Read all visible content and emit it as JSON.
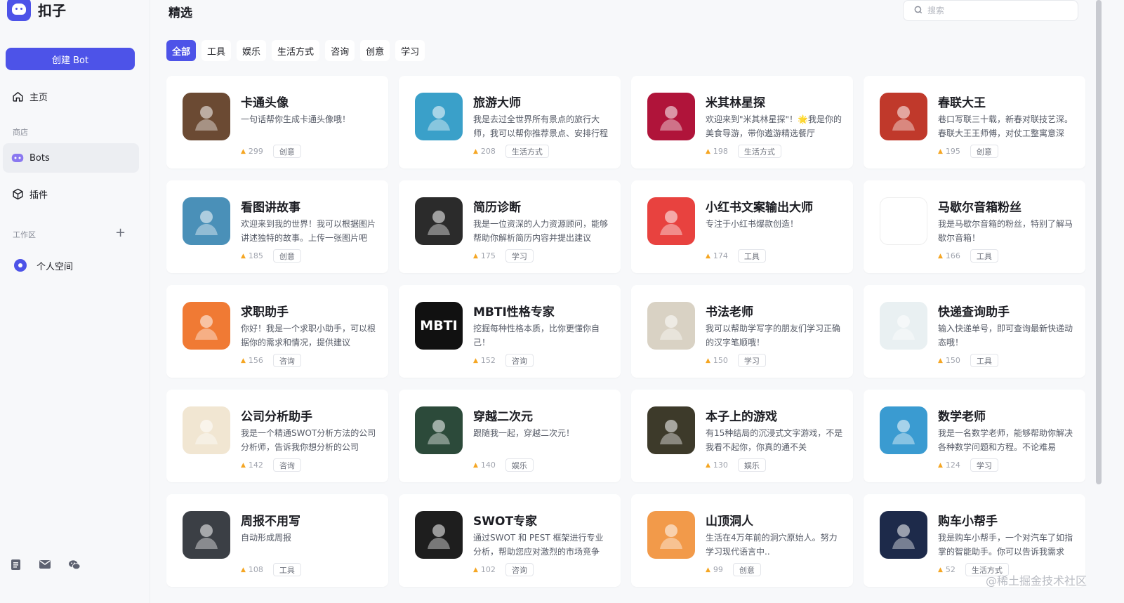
{
  "app": {
    "name": "扣子"
  },
  "sidebar": {
    "create_label": "创建 Bot",
    "home_label": "主页",
    "store_label": "商店",
    "bots_label": "Bots",
    "plugins_label": "插件",
    "workspace_label": "工作区",
    "personal_label": "个人空间"
  },
  "header": {
    "title": "精选",
    "search_placeholder": "搜索"
  },
  "tabs": [
    "全部",
    "工具",
    "娱乐",
    "生活方式",
    "咨询",
    "创意",
    "学习"
  ],
  "cards": [
    {
      "title": "卡通头像",
      "desc": "一句话帮你生成卡通头像哦！",
      "count": "299",
      "tag": "创意",
      "bg": "#6b4a33",
      "icon": "cartoon-girl-icon"
    },
    {
      "title": "旅游大师",
      "desc": "我是去过全世界所有景点的旅行大师，我可以帮你推荐景点、安排行程",
      "count": "208",
      "tag": "生活方式",
      "bg": "#3aa0c9",
      "icon": "traveler-icon"
    },
    {
      "title": "米其林星探",
      "desc": "欢迎来到\"米其林星探\"！🌟我是你的美食导游，带你遨游精选餐厅",
      "count": "198",
      "tag": "生活方式",
      "bg": "#b0143a",
      "icon": "michelin-flower-icon"
    },
    {
      "title": "春联大王",
      "desc": "巷口写联三十载，新春对联技艺深。春联大王王师傅，对仗工整寓意深",
      "count": "195",
      "tag": "创意",
      "bg": "#c0392b",
      "icon": "couplet-master-icon"
    },
    {
      "title": "看图讲故事",
      "desc": "欢迎来到我的世界！我可以根据图片讲述独特的故事。上传一张图片吧",
      "count": "185",
      "tag": "创意",
      "bg": "#4a90b8",
      "icon": "storybook-icon"
    },
    {
      "title": "简历诊断",
      "desc": "我是一位资深的人力资源顾问，能够帮助你解析简历内容并提出建议",
      "count": "175",
      "tag": "学习",
      "bg": "#2b2b2b",
      "icon": "recruiter-icon"
    },
    {
      "title": "小红书文案输出大师",
      "desc": "专注于小红书爆款创造！",
      "count": "174",
      "tag": "工具",
      "bg": "#e8423f",
      "icon": "xiaohongshu-icon"
    },
    {
      "title": "马歇尔音箱粉丝",
      "desc": "我是马歇尔音箱的粉丝，特别了解马歇尔音箱！",
      "count": "166",
      "tag": "工具",
      "bg": "#ffffff",
      "icon": "speaker-icon"
    },
    {
      "title": "求职助手",
      "desc": "你好！我是一个求职小助手，可以根据你的需求和情况，提供建议",
      "count": "156",
      "tag": "咨询",
      "bg": "#f07a34",
      "icon": "job-assistant-icon"
    },
    {
      "title": "MBTI性格专家",
      "desc": "挖掘每种性格本质，比你更懂你自己！",
      "count": "152",
      "tag": "咨询",
      "bg": "#111111",
      "icon": "mbti-icon",
      "avatar_text": "MBTI"
    },
    {
      "title": "书法老师",
      "desc": "我可以帮助学写字的朋友们学习正确的汉字笔顺哦！",
      "count": "150",
      "tag": "学习",
      "bg": "#d9d2c4",
      "icon": "calligraphy-teacher-icon"
    },
    {
      "title": "快递查询助手",
      "desc": "输入快递单号，即可查询最新快递动态哦！",
      "count": "150",
      "tag": "工具",
      "bg": "#e9f0f2",
      "icon": "delivery-truck-icon"
    },
    {
      "title": "公司分析助手",
      "desc": "我是一个精通SWOT分析方法的公司分析师，告诉我你想分析的公司",
      "count": "142",
      "tag": "咨询",
      "bg": "#f1e6d2",
      "icon": "company-chart-icon"
    },
    {
      "title": "穿越二次元",
      "desc": "跟随我一起，穿越二次元！",
      "count": "140",
      "tag": "娱乐",
      "bg": "#2c4a3a",
      "icon": "anime-character-icon"
    },
    {
      "title": "本子上的游戏",
      "desc": "有15种结局的沉浸式文字游戏，不是我看不起你，你真的通不关",
      "count": "130",
      "tag": "娱乐",
      "bg": "#3d3a2a",
      "icon": "notebook-game-icon"
    },
    {
      "title": "数学老师",
      "desc": "我是一名数学老师，能够帮助你解决各种数学问题和方程。不论难易",
      "count": "124",
      "tag": "学习",
      "bg": "#3a9bd1",
      "icon": "math-teacher-icon"
    },
    {
      "title": "周报不用写",
      "desc": "自动形成周报",
      "count": "108",
      "tag": "工具",
      "bg": "#3b3f45",
      "icon": "weekly-report-icon"
    },
    {
      "title": "SWOT专家",
      "desc": "通过SWOT 和 PEST 框架进行专业分析，帮助您应对激烈的市场竞争",
      "count": "102",
      "tag": "咨询",
      "bg": "#1e1e1e",
      "icon": "swot-icon"
    },
    {
      "title": "山顶洞人",
      "desc": "生活在4万年前的洞穴原始人。努力学习现代语言中..",
      "count": "99",
      "tag": "创意",
      "bg": "#f29a4a",
      "icon": "caveman-icon"
    },
    {
      "title": "购车小帮手",
      "desc": "我是购车小帮手，一个对汽车了如指掌的智能助手。你可以告诉我需求",
      "count": "52",
      "tag": "生活方式",
      "bg": "#1d2a4a",
      "icon": "car-icon"
    }
  ],
  "watermark": "@稀土掘金技术社区"
}
